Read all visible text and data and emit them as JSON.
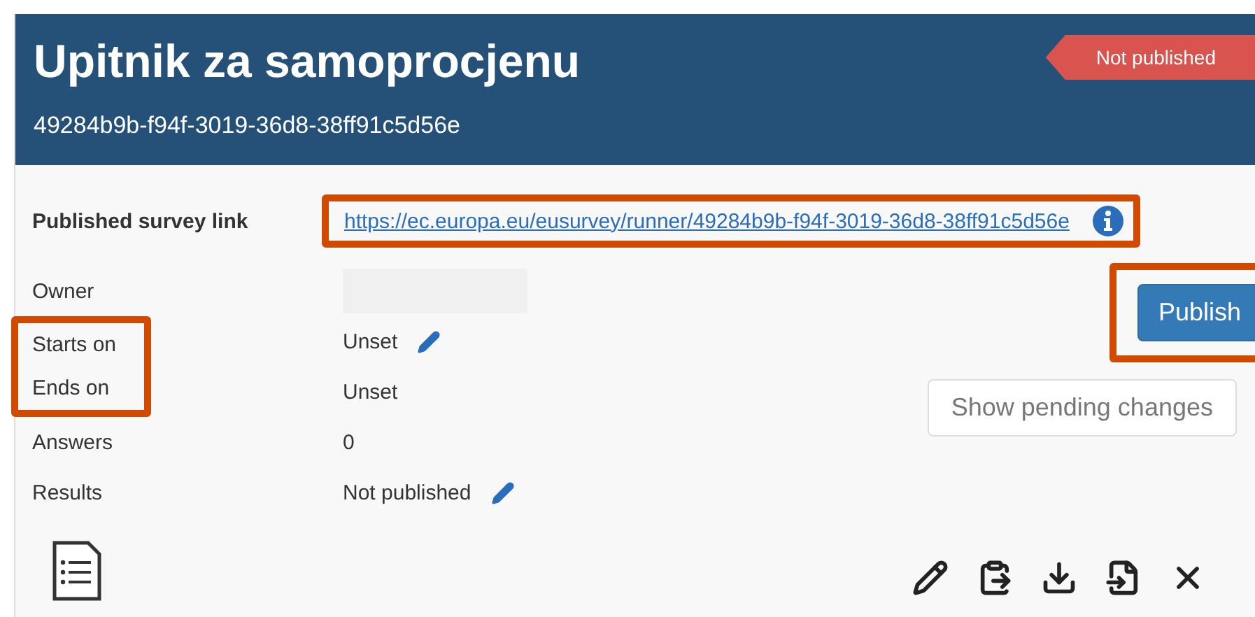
{
  "header": {
    "title": "Upitnik za samoprocjenu",
    "survey_id": "49284b9b-f94f-3019-36d8-38ff91c5d56e",
    "status": "Not published"
  },
  "link": {
    "label": "Published survey link",
    "url": "https://ec.europa.eu/eusurvey/runner/49284b9b-f94f-3019-36d8-38ff91c5d56e",
    "highlighted": true
  },
  "fields": [
    {
      "label": "Owner",
      "kind": "blank",
      "highlighted": false
    },
    {
      "label": "Starts on",
      "value": "Unset",
      "kind": "editable",
      "highlighted": true
    },
    {
      "label": "Ends on",
      "value": "Unset",
      "kind": "text",
      "highlighted": true
    },
    {
      "label": "Answers",
      "value": "0",
      "kind": "text",
      "highlighted": false
    },
    {
      "label": "Results",
      "value": "Not published",
      "kind": "editable",
      "highlighted": false
    }
  ],
  "buttons": [
    {
      "label": "Publish",
      "kind": "primary",
      "highlighted": true
    },
    {
      "label": "Show pending changes",
      "kind": "default",
      "highlighted": false
    }
  ]
}
